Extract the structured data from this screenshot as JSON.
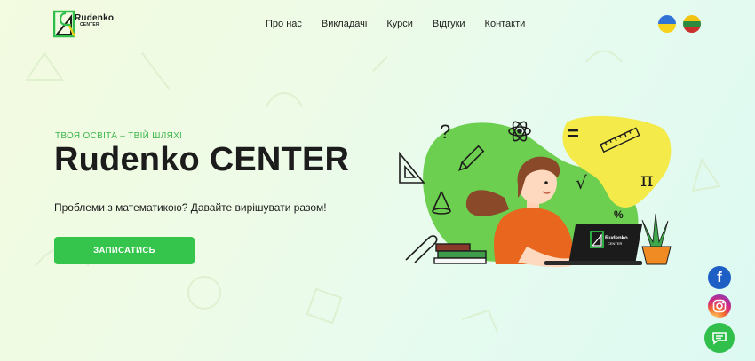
{
  "header": {
    "logo": {
      "name": "Rudenko",
      "sub": "CENTER"
    },
    "nav": [
      "Про нас",
      "Викладачі",
      "Курси",
      "Відгуки",
      "Контакти"
    ],
    "languages": [
      "uk",
      "lt"
    ]
  },
  "hero": {
    "tagline": "ТВОЯ ОСВІТА – ТВІЙ ШЛЯХ!",
    "title": "Rudenko CENTER",
    "subtitle": "Проблеми з математикою? Давайте вирішувати разом!",
    "cta_label": "ЗАПИСАТИСЬ"
  },
  "illustration": {
    "symbols": [
      "?",
      "=",
      "√",
      "π",
      "%"
    ],
    "laptop_logo": {
      "name": "Rudenko",
      "sub": "CENTER"
    }
  },
  "social": [
    "facebook",
    "instagram",
    "chat"
  ],
  "colors": {
    "accent": "#35c44c",
    "title": "#1c1c1c",
    "tagline": "#3cb64b",
    "blob_green": "#6ccf4f",
    "blob_yellow": "#f4ea4a",
    "hair": "#8a4a2a",
    "sweater": "#e8661e"
  }
}
